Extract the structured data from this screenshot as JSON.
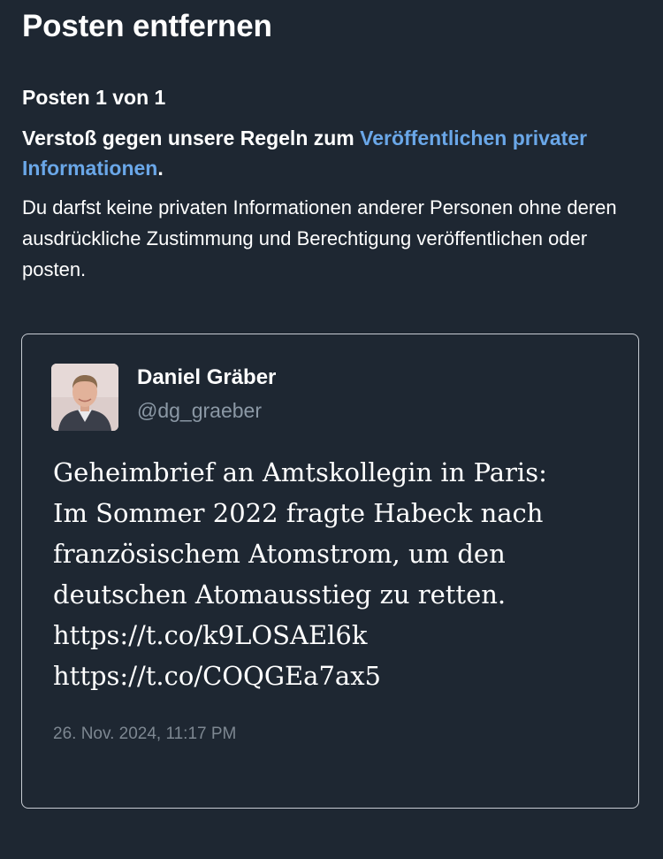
{
  "header": {
    "title": "Posten entfernen"
  },
  "notice": {
    "counter": "Posten 1 von 1",
    "violation_prefix": "Verstoß gegen unsere Regeln zum ",
    "violation_link": "Veröffentlichen privater Informationen",
    "violation_suffix": ".",
    "explanation": "Du darfst keine privaten Informationen anderer Personen ohne deren ausdrückliche Zustimmung und Berechtigung veröffentlichen oder posten."
  },
  "post": {
    "author_name": "Daniel Gräber",
    "author_handle": "@dg_graeber",
    "text_lines": [
      "Geheimbrief an Amtskollegin in Paris:",
      "Im Sommer 2022 fragte Habeck nach",
      "französischem Atomstrom, um den",
      "deutschen Atomausstieg zu retten.",
      "https://t.co/k9LOSAEl6k",
      "https://t.co/COQGEa7ax5"
    ],
    "timestamp": "26. Nov. 2024, 11:17 PM"
  },
  "colors": {
    "background": "#1e2732",
    "link": "#6aa7e8",
    "secondary_text": "#8b98a5",
    "card_border": "#c7ccd3"
  }
}
